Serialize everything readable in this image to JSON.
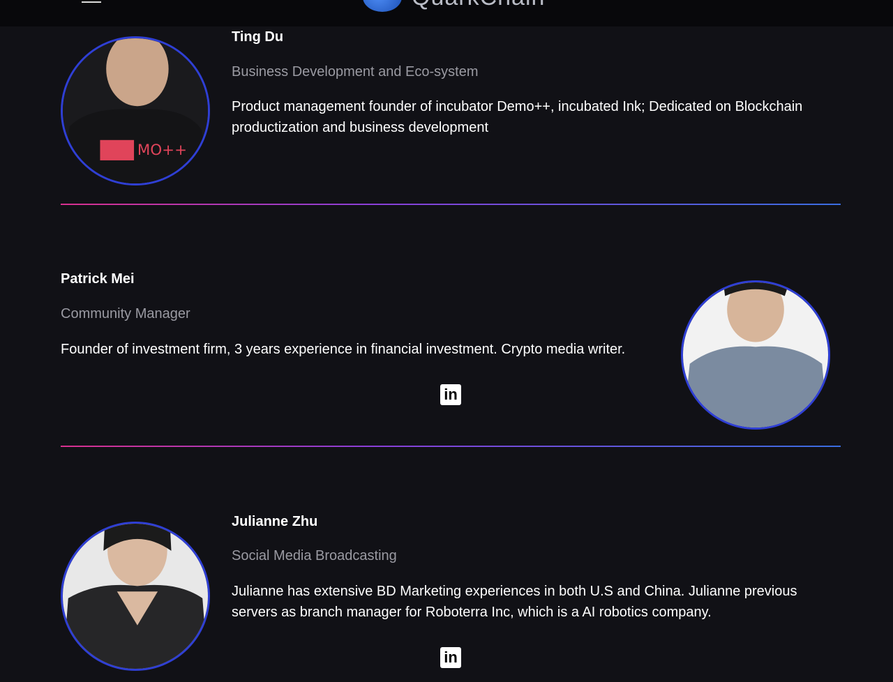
{
  "header": {
    "brand_name": "QuarkChain"
  },
  "members": [
    {
      "name": "Ting Du",
      "role": "Business Development and Eco-system",
      "bio": "Product management founder of incubator Demo++, incubated Ink; Dedicated on Blockchain productization and business development"
    },
    {
      "name": "Patrick Mei",
      "role": "Community Manager",
      "bio": "Founder of investment firm, 3 years experience in financial investment. Crypto media writer.",
      "linkedin_label": "in"
    },
    {
      "name": "Julianne Zhu",
      "role": "Social Media Broadcasting",
      "bio": "Julianne has extensive BD Marketing experiences in both U.S and China. Julianne previous servers as branch manager for Roboterra Inc, which is a AI robotics company.",
      "linkedin_label": "in"
    }
  ],
  "colors": {
    "background": "#111116",
    "avatar_ring": "#2f3fd4",
    "divider_start": "#d8308e",
    "divider_end": "#3a6de0"
  }
}
